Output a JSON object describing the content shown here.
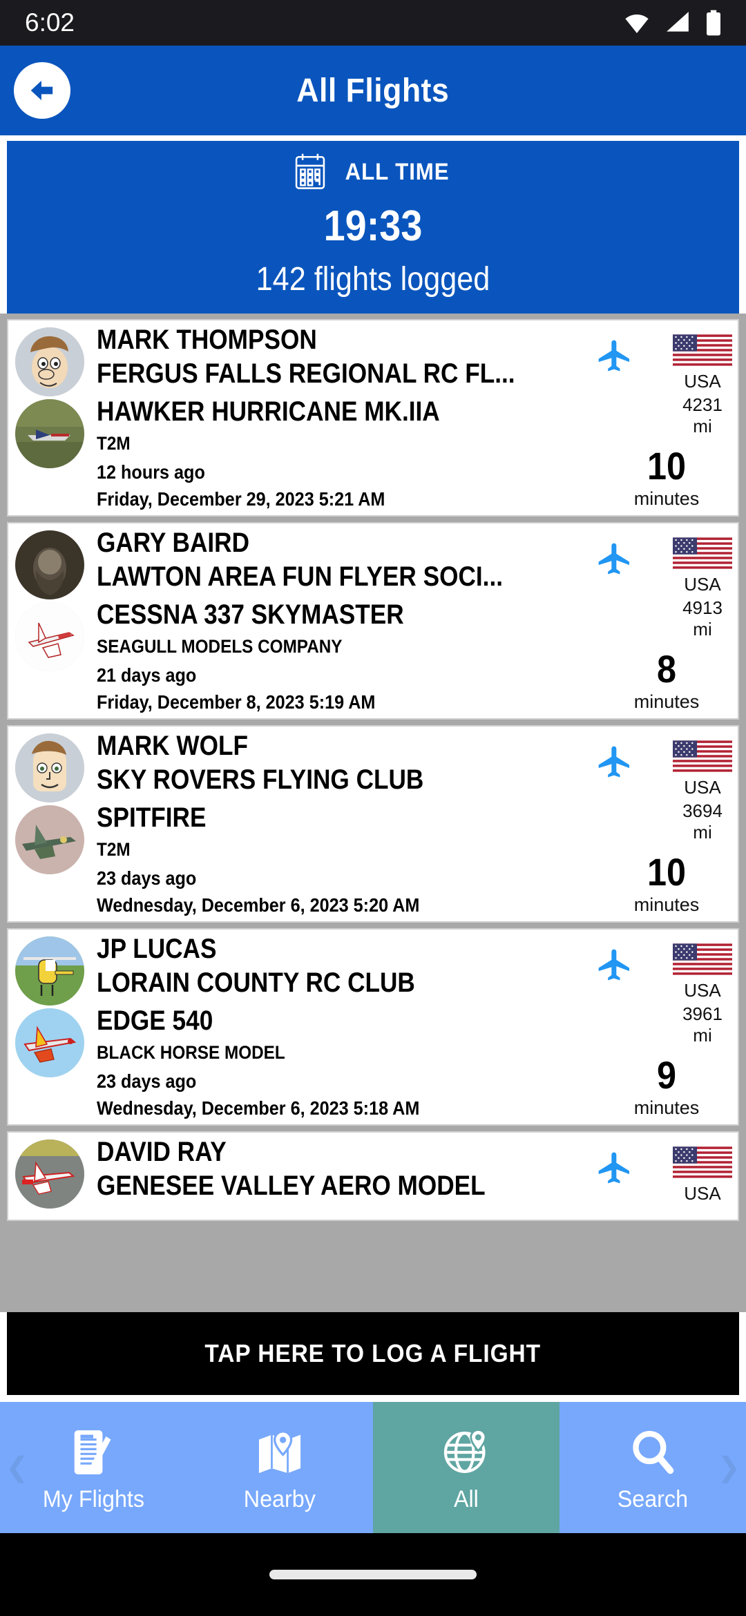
{
  "status_bar": {
    "time": "6:02",
    "icons": [
      "wifi-icon",
      "cellular-signal-icon",
      "battery-icon"
    ]
  },
  "header": {
    "title": "All Flights",
    "back_icon": "back-arrow-icon",
    "background_color": "#0a55bd"
  },
  "stats_banner": {
    "icon": "calendar-icon",
    "label": "ALL TIME",
    "total_time": "19:33",
    "flights_logged": "142 flights logged",
    "background_color": "#0a55bd"
  },
  "flights": [
    {
      "pilot": "MARK THOMPSON",
      "club": "FERGUS FALLS REGIONAL RC FL...",
      "model": "HAWKER HURRICANE MK.IIA",
      "manufacturer": "T2M",
      "relative_time": "12 hours ago",
      "date": "Friday, December 29, 2023 5:21 AM",
      "country": "USA",
      "distance": "4231 mi",
      "duration": "10",
      "duration_label": "minutes",
      "avatar": "cartoon-man-brown-hair",
      "model_photo": "hurricane-photo"
    },
    {
      "pilot": "GARY BAIRD",
      "club": "LAWTON AREA FUN FLYER SOCI...",
      "model": "CESSNA 337 SKYMASTER",
      "manufacturer": "SEAGULL MODELS COMPANY",
      "relative_time": "21 days ago",
      "date": "Friday, December 8, 2023 5:19 AM",
      "country": "USA",
      "distance": "4913 mi",
      "duration": "8",
      "duration_label": "minutes",
      "avatar": "photo-bearded-man",
      "model_photo": "cessna-photo"
    },
    {
      "pilot": "MARK WOLF",
      "club": "SKY ROVERS FLYING CLUB",
      "model": "SPITFIRE",
      "manufacturer": "T2M",
      "relative_time": "23 days ago",
      "date": "Wednesday, December 6, 2023 5:20 AM",
      "country": "USA",
      "distance": "3694 mi",
      "duration": "10",
      "duration_label": "minutes",
      "avatar": "cartoon-man-smiling",
      "model_photo": "spitfire-photo"
    },
    {
      "pilot": "JP LUCAS",
      "club": "LORAIN COUNTY RC CLUB",
      "model": "EDGE 540",
      "manufacturer": "BLACK HORSE MODEL",
      "relative_time": "23 days ago",
      "date": "Wednesday, December 6, 2023 5:18 AM",
      "country": "USA",
      "distance": "3961 mi",
      "duration": "9",
      "duration_label": "minutes",
      "avatar": "helicopter-photo",
      "model_photo": "edge540-photo"
    },
    {
      "pilot": "DAVID RAY",
      "club": "GENESEE VALLEY AERO MODEL",
      "model": "",
      "manufacturer": "",
      "relative_time": "",
      "date": "",
      "country": "USA",
      "distance": "",
      "duration": "",
      "duration_label": "",
      "avatar": "plane-runway-photo",
      "model_photo": ""
    }
  ],
  "log_button": {
    "label": "TAP HERE TO LOG A FLIGHT",
    "background_color": "#000000"
  },
  "bottom_nav": {
    "background_color": "#77a8fc",
    "active_color": "#5fa5a2",
    "items": [
      {
        "label": "My Flights",
        "icon": "notepad-pencil-icon",
        "active": false
      },
      {
        "label": "Nearby",
        "icon": "map-pin-icon",
        "active": false
      },
      {
        "label": "All",
        "icon": "globe-pin-icon",
        "active": true
      },
      {
        "label": "Search",
        "icon": "search-icon",
        "active": false
      }
    ]
  }
}
